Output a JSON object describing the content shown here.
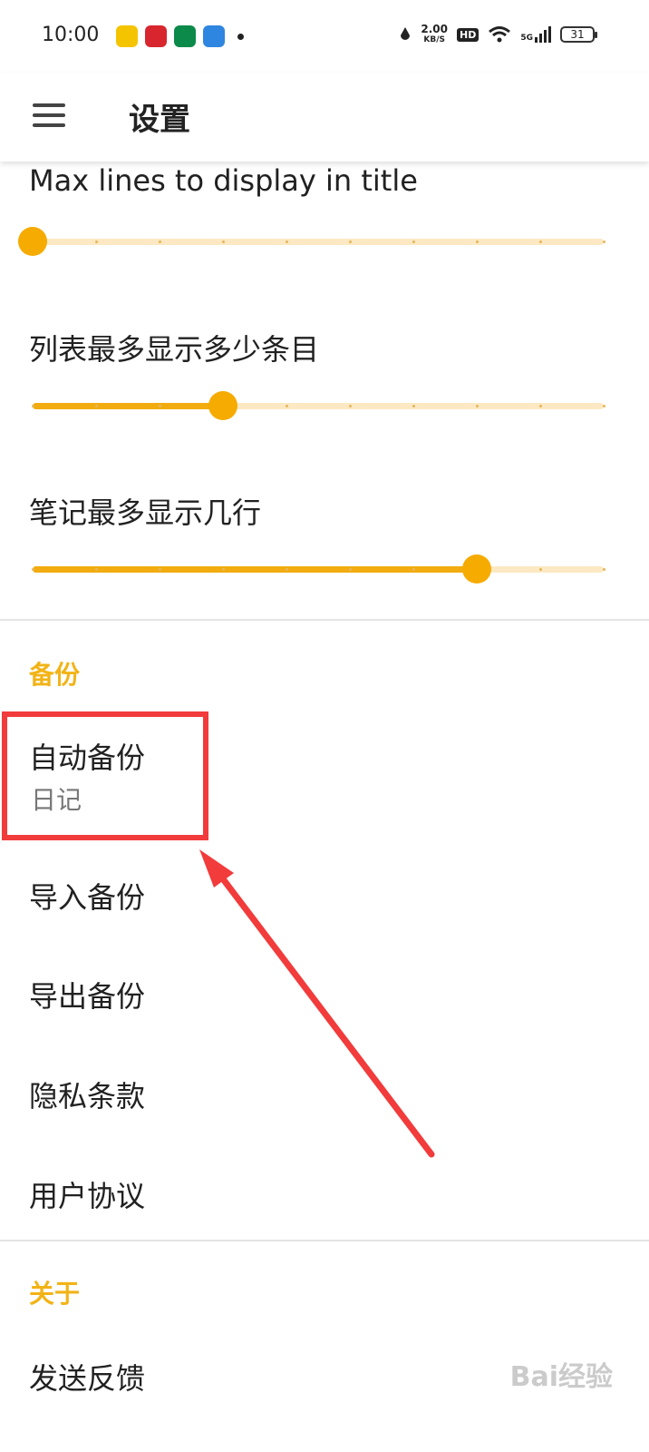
{
  "status_bar": {
    "time": "10:00",
    "speed_value": "2.00",
    "speed_unit": "KB/S",
    "hd_badge": "HD",
    "network": "5G",
    "battery": "31"
  },
  "toolbar": {
    "title": "设置"
  },
  "sliders": [
    {
      "title": "Max lines to display in title",
      "value_fraction": 0.0,
      "steps": 10
    },
    {
      "title": "列表最多显示多少条目",
      "value_fraction": 0.333,
      "steps": 10
    },
    {
      "title": "笔记最多显示几行",
      "value_fraction": 0.778,
      "steps": 10
    }
  ],
  "sections": {
    "backup": {
      "header": "备份",
      "items": [
        {
          "label": "自动备份",
          "summary": "日记"
        },
        {
          "label": "导入备份"
        },
        {
          "label": "导出备份"
        },
        {
          "label": "隐私条款"
        },
        {
          "label": "用户协议"
        }
      ]
    },
    "about": {
      "header": "关于",
      "items": [
        {
          "label": "发送反馈"
        }
      ]
    }
  },
  "watermark": "Bai经验",
  "colors": {
    "accent": "#f6ab00",
    "highlight": "#f23b3b",
    "section_header": "#f2b316"
  }
}
